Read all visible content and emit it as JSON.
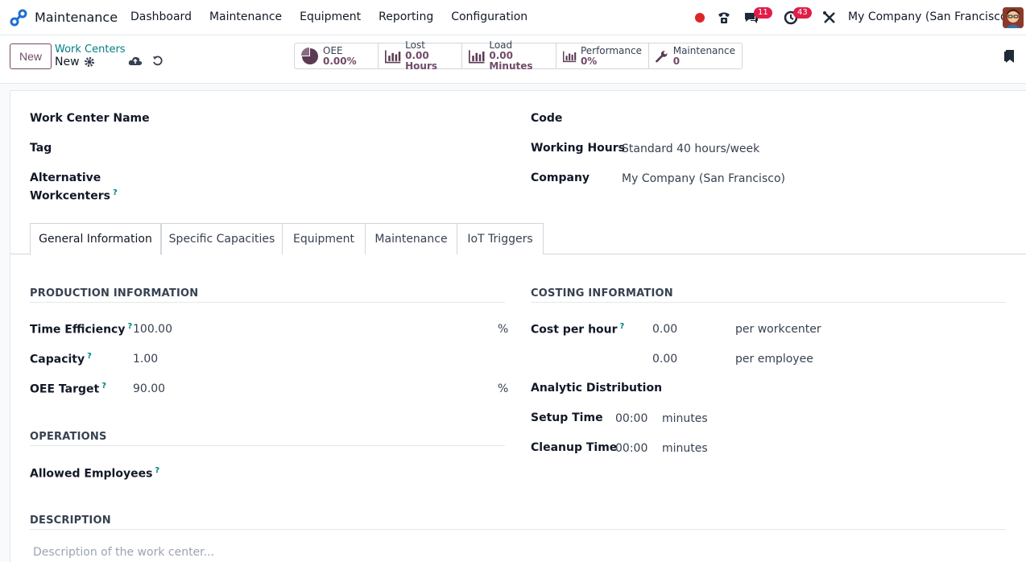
{
  "navbar": {
    "app_name": "Maintenance",
    "menu": [
      "Dashboard",
      "Maintenance",
      "Equipment",
      "Reporting",
      "Configuration"
    ],
    "messages_badge": "11",
    "activities_badge": "43",
    "company": "My Company (San Francisco)"
  },
  "control": {
    "new_label": "New",
    "breadcrumb_parent": "Work Centers",
    "breadcrumb_current": "New",
    "stats": [
      {
        "label": "OEE",
        "value": "0.00%"
      },
      {
        "label": "Lost",
        "value": "0.00 Hours"
      },
      {
        "label": "Load",
        "value": "0.00 Minutes"
      },
      {
        "label": "Performance",
        "value": "0%"
      },
      {
        "label": "Maintenance",
        "value": "0"
      }
    ]
  },
  "form": {
    "work_center_name_label": "Work Center Name",
    "tag_label": "Tag",
    "alternative_label_1": "Alternative",
    "alternative_label_2": "Workcenters",
    "code_label": "Code",
    "working_hours_label": "Working Hours",
    "working_hours_value": "Standard 40 hours/week",
    "company_label": "Company",
    "company_value": "My Company (San Francisco)",
    "help_mark": "?"
  },
  "tabs": [
    "General Information",
    "Specific Capacities",
    "Equipment",
    "Maintenance",
    "IoT Triggers"
  ],
  "production": {
    "title": "PRODUCTION INFORMATION",
    "time_efficiency_label": "Time Efficiency",
    "time_efficiency_value": "100.00",
    "time_efficiency_unit": "%",
    "capacity_label": "Capacity",
    "capacity_value": "1.00",
    "oee_target_label": "OEE Target",
    "oee_target_value": "90.00",
    "oee_target_unit": "%"
  },
  "operations": {
    "title": "OPERATIONS",
    "allowed_employees_label": "Allowed Employees"
  },
  "costing": {
    "title": "COSTING INFORMATION",
    "cost_per_hour_label": "Cost per hour",
    "cost_workcenter_value": "0.00",
    "cost_workcenter_unit": "per workcenter",
    "cost_employee_value": "0.00",
    "cost_employee_unit": "per employee",
    "analytic_label": "Analytic Distribution",
    "setup_label": "Setup Time",
    "setup_value": "00:00",
    "setup_unit": "minutes",
    "cleanup_label": "Cleanup Time",
    "cleanup_value": "00:00",
    "cleanup_unit": "minutes"
  },
  "description": {
    "title": "DESCRIPTION",
    "placeholder": "Description of the work center..."
  },
  "colors": {
    "brand": "#714b67",
    "link": "#017e84",
    "badge": "#e11d48"
  }
}
